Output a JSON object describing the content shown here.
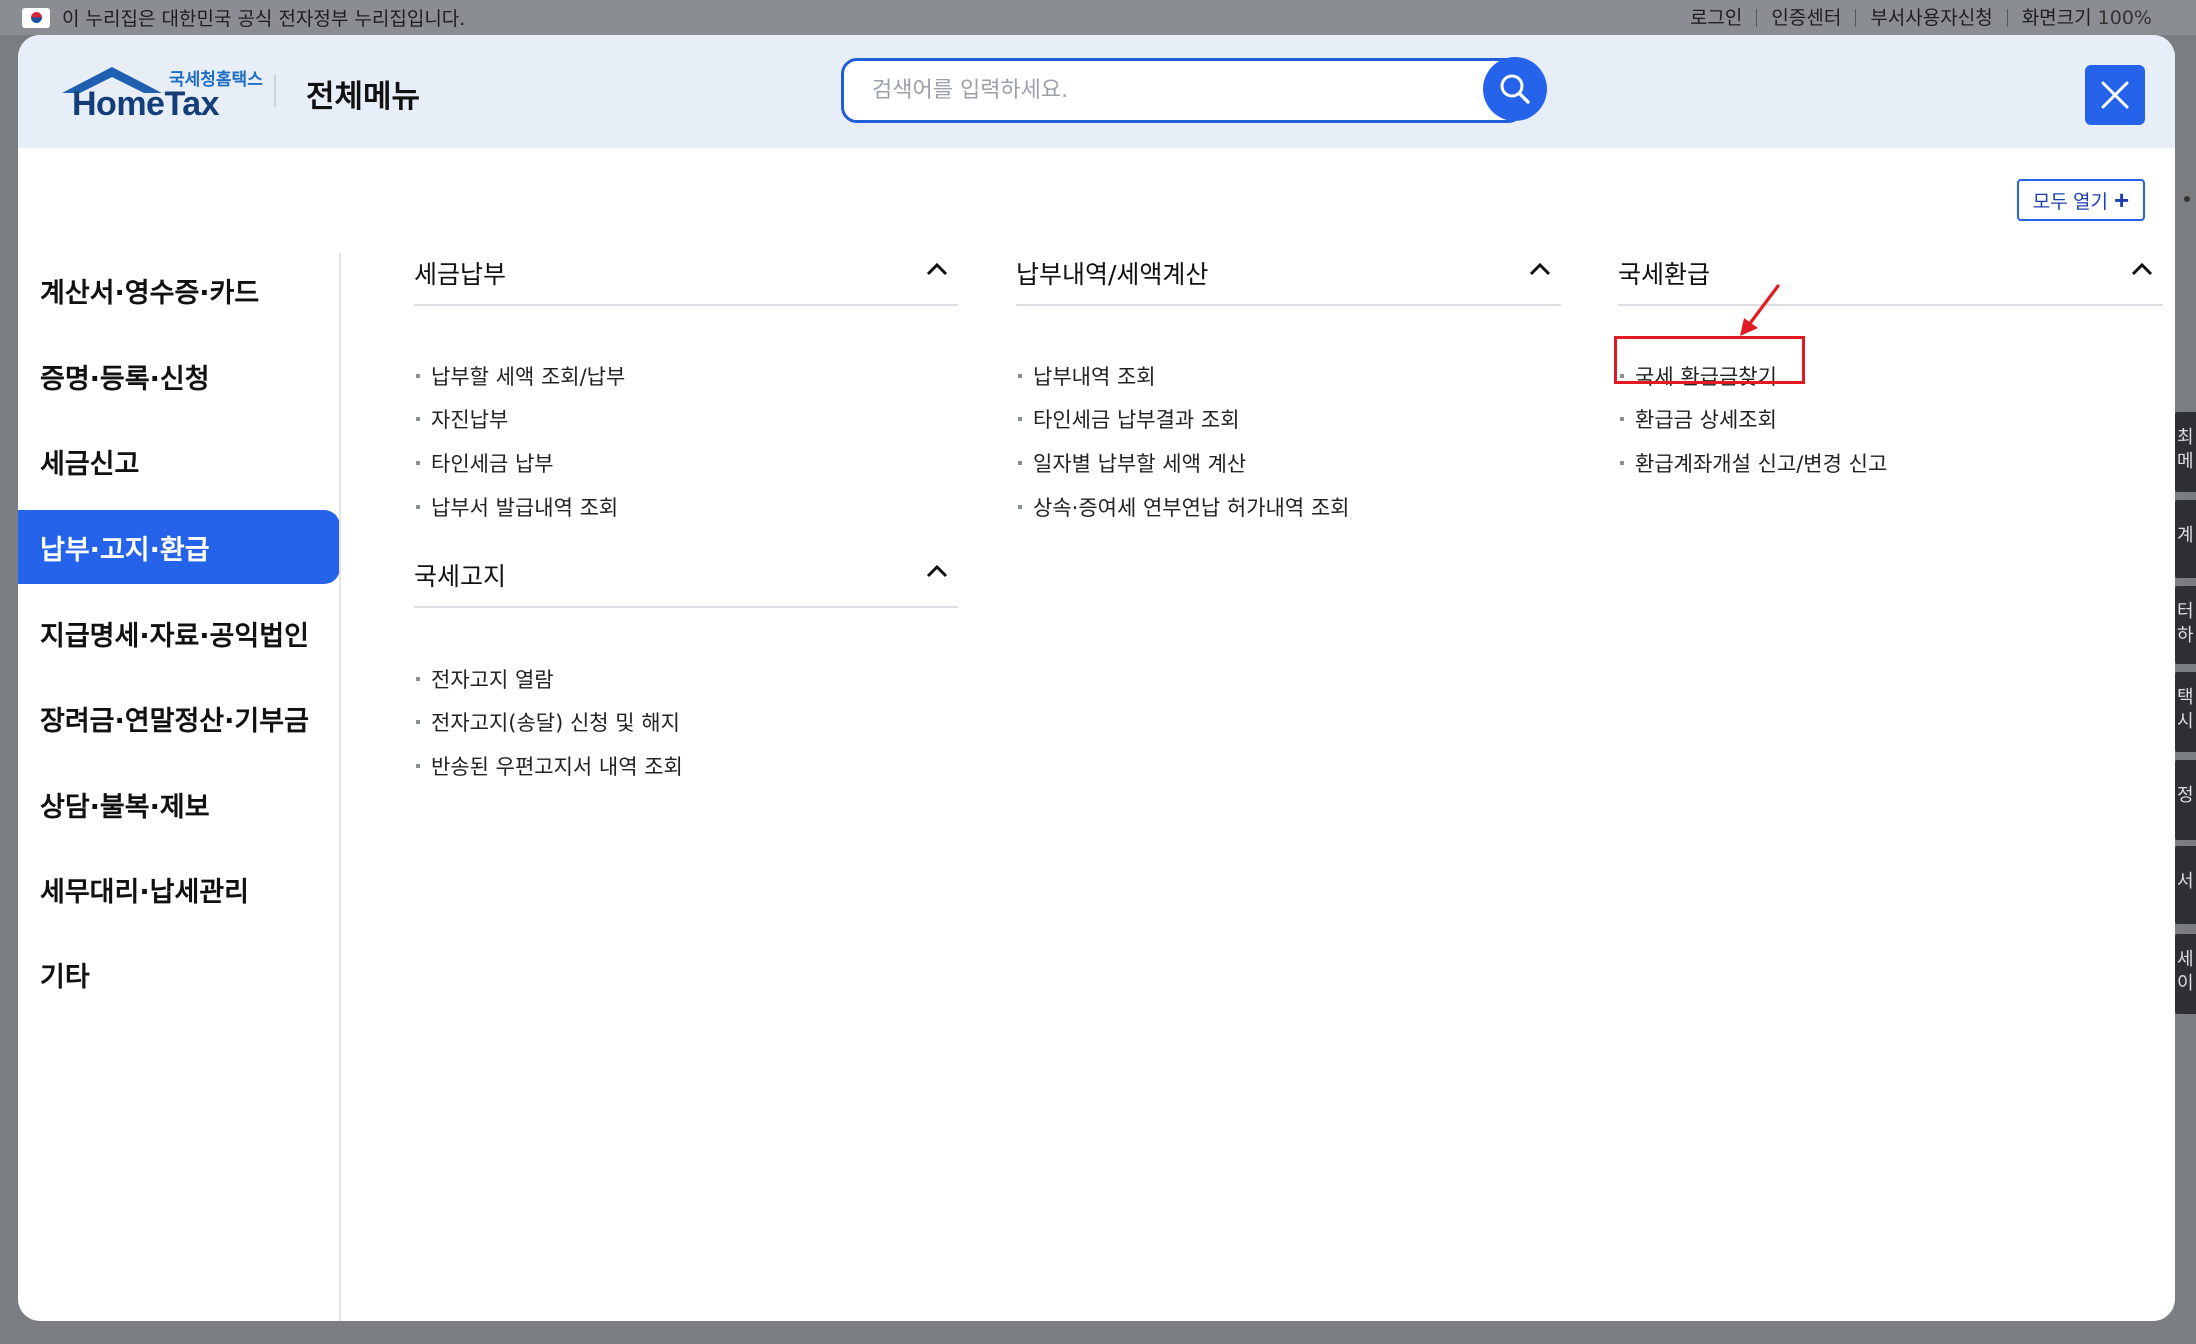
{
  "topbar": {
    "gov_notice": "이 누리집은 대한민국 공식 전자정부 누리집입니다.",
    "links": [
      "로그인",
      "인증센터",
      "부서사용자신청"
    ],
    "zoom_label": "화면크기",
    "zoom_value": "100%"
  },
  "side_strip": [
    "최\n메",
    "계",
    "터\n하",
    "택\n시",
    "정",
    "서",
    "세\n이"
  ],
  "header": {
    "logo_sub": "국세청홈택스",
    "logo_main": "HomeTax",
    "title": "전체메뉴",
    "search_placeholder": "검색어를 입력하세요.",
    "expand_all_label": "모두 열기",
    "expand_all_icon": "+"
  },
  "icons": {
    "search": "search-icon",
    "close": "close-icon",
    "collapse": "chevron-up-icon",
    "accent": "#2563eb",
    "highlight": "#e21b23"
  },
  "left_nav": {
    "items": [
      "계산서·영수증·카드",
      "증명·등록·신청",
      "세금신고",
      "납부·고지·환급",
      "지급명세·자료·공익법인",
      "장려금·연말정산·기부금",
      "상담·불복·제보",
      "세무대리·납세관리",
      "기타"
    ],
    "active_index": 3
  },
  "sections": {
    "tax_payment": {
      "title": "세금납부",
      "links": [
        "납부할 세액 조회/납부",
        "자진납부",
        "타인세금 납부",
        "납부서 발급내역 조회"
      ]
    },
    "tax_notice": {
      "title": "국세고지",
      "links": [
        "전자고지 열람",
        "전자고지(송달) 신청 및 해지",
        "반송된 우편고지서 내역 조회"
      ]
    },
    "payment_history": {
      "title": "납부내역/세액계산",
      "links": [
        "납부내역 조회",
        "타인세금 납부결과 조회",
        "일자별 납부할 세액 계산",
        "상속·증여세 연부연납 허가내역 조회"
      ]
    },
    "tax_refund": {
      "title": "국세환급",
      "links": [
        "국세 환급금찾기",
        "환급금 상세조회",
        "환급계좌개설 신고/변경 신고"
      ]
    }
  }
}
